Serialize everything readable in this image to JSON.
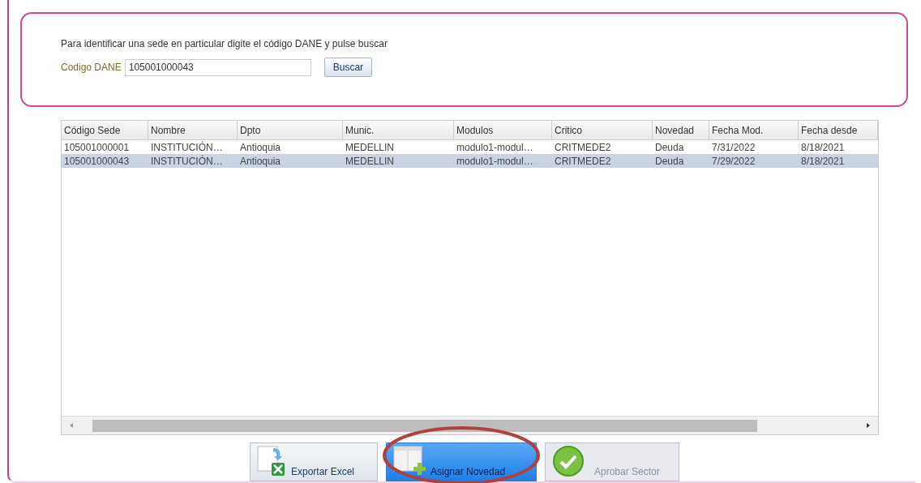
{
  "search_panel": {
    "instructions": "Para identificar una sede en particular digite el código DANE y pulse buscar",
    "field_label": "Codigo DANE",
    "field_value": "105001000043",
    "button": "Buscar"
  },
  "table": {
    "columns": [
      "Código Sede",
      "Nombre",
      "Dpto",
      "Munic.",
      "Modulos",
      "Critico",
      "Novedad",
      "Fecha Mod.",
      "Fecha desde"
    ],
    "rows": [
      {
        "selected": false,
        "cells": [
          "105001000001",
          "INSTITUCIÓN…",
          "Antioquia",
          "MEDELLIN",
          "modulo1-modul…",
          "CRITMEDE2",
          "Deuda",
          "7/31/2022",
          "8/18/2021"
        ]
      },
      {
        "selected": true,
        "cells": [
          "105001000043",
          "INSTITUCIÓN…",
          "Antioquia",
          "MEDELLIN",
          "modulo1-modul…",
          "CRITMEDE2",
          "Deuda",
          "7/29/2022",
          "8/18/2021"
        ]
      }
    ]
  },
  "buttons": [
    {
      "kind": "excel",
      "label": "Exportar Excel",
      "active": false,
      "disabled": false,
      "circled": false
    },
    {
      "kind": "add",
      "label": "Asignar Novedad",
      "active": true,
      "disabled": false,
      "circled": true
    },
    {
      "kind": "approve",
      "label": "Aprobar Sector",
      "active": false,
      "disabled": true,
      "circled": false
    }
  ]
}
